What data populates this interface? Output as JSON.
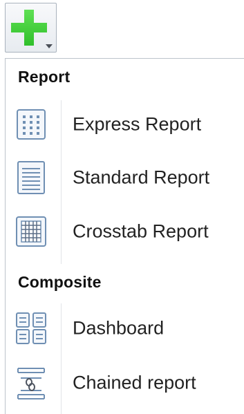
{
  "toolbar": {
    "add_button": {
      "icon": "plus-icon",
      "dropdown_icon": "chevron-down-icon",
      "color": "#3fcf3a"
    }
  },
  "menu": {
    "sections": [
      {
        "label": "Report",
        "items": [
          {
            "label": "Express Report",
            "icon": "express-report-icon"
          },
          {
            "label": "Standard Report",
            "icon": "standard-report-icon"
          },
          {
            "label": "Crosstab Report",
            "icon": "crosstab-report-icon"
          }
        ]
      },
      {
        "label": "Composite",
        "items": [
          {
            "label": "Dashboard",
            "icon": "dashboard-icon"
          },
          {
            "label": "Chained report",
            "icon": "chained-report-icon"
          }
        ]
      }
    ]
  },
  "colors": {
    "icon_stroke": "#6f8fb3",
    "icon_fill": "#f4f7fb",
    "plus_green": "#3fcf3a",
    "border": "#bcc3cb"
  }
}
